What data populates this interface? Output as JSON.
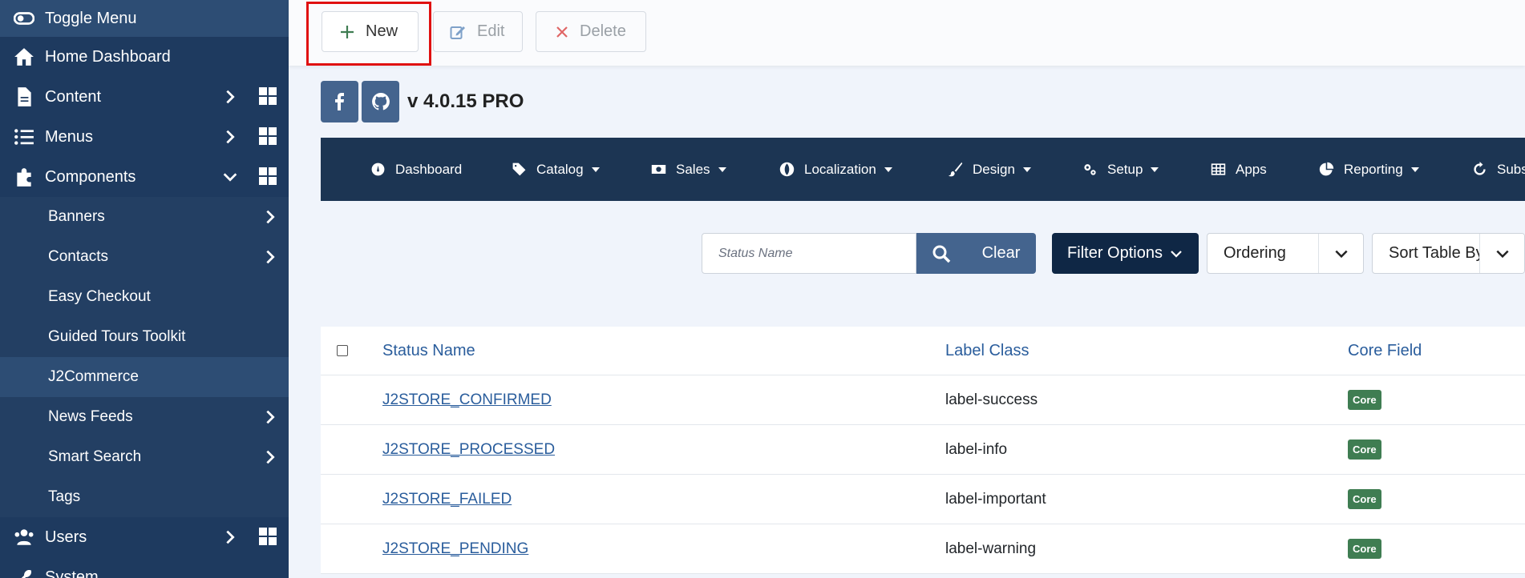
{
  "sidebar": {
    "toggle_label": "Toggle Menu",
    "home_label": "Home Dashboard",
    "content_label": "Content",
    "menus_label": "Menus",
    "components_label": "Components",
    "sub_items": [
      {
        "label": "Banners"
      },
      {
        "label": "Contacts"
      },
      {
        "label": "Easy Checkout"
      },
      {
        "label": "Guided Tours Toolkit"
      },
      {
        "label": "J2Commerce"
      },
      {
        "label": "News Feeds"
      },
      {
        "label": "Smart Search"
      },
      {
        "label": "Tags"
      }
    ],
    "users_label": "Users",
    "system_label": "System"
  },
  "toolbar": {
    "new_label": "New",
    "edit_label": "Edit",
    "delete_label": "Delete"
  },
  "version": "v 4.0.15 PRO",
  "nav": {
    "items": [
      {
        "label": "Dashboard"
      },
      {
        "label": "Catalog"
      },
      {
        "label": "Sales"
      },
      {
        "label": "Localization"
      },
      {
        "label": "Design"
      },
      {
        "label": "Setup"
      },
      {
        "label": "Apps"
      },
      {
        "label": "Reporting"
      },
      {
        "label": "Subs"
      }
    ]
  },
  "filters": {
    "search_placeholder": "Status Name",
    "clear_label": "Clear",
    "filter_options_label": "Filter Options",
    "ordering_label": "Ordering",
    "sort_label": "Sort Table By"
  },
  "table": {
    "headers": {
      "status_name": "Status Name",
      "label_class": "Label Class",
      "core_field": "Core Field"
    },
    "rows": [
      {
        "status": "J2STORE_CONFIRMED",
        "label_class": "label-success",
        "core": "Core"
      },
      {
        "status": "J2STORE_PROCESSED",
        "label_class": "label-info",
        "core": "Core"
      },
      {
        "status": "J2STORE_FAILED",
        "label_class": "label-important",
        "core": "Core"
      },
      {
        "status": "J2STORE_PENDING",
        "label_class": "label-warning",
        "core": "Core"
      }
    ]
  },
  "colors": {
    "sidebar_bg": "#1e3a5f",
    "navbar_bg": "#1c3553",
    "accent": "#44648e",
    "core_badge": "#3f7d52",
    "highlight": "#e01010"
  }
}
